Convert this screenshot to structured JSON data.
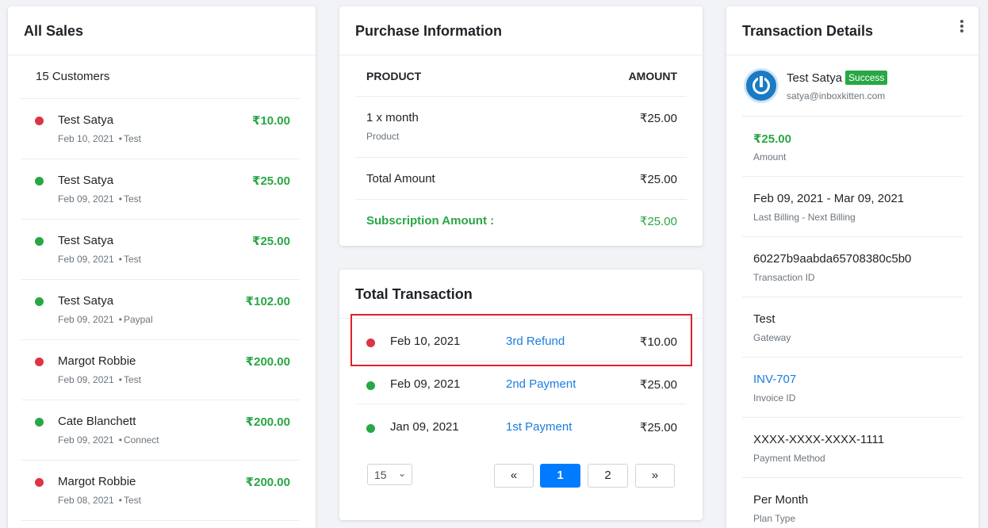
{
  "all_sales": {
    "title": "All Sales",
    "customers_count": "15 Customers",
    "items": [
      {
        "name": "Test Satya",
        "date": "Feb 10, 2021",
        "gateway": "Test",
        "amount": "₹10.00",
        "status_color": "#dc3545"
      },
      {
        "name": "Test Satya",
        "date": "Feb 09, 2021",
        "gateway": "Test",
        "amount": "₹25.00",
        "status_color": "#28a745"
      },
      {
        "name": "Test Satya",
        "date": "Feb 09, 2021",
        "gateway": "Test",
        "amount": "₹25.00",
        "status_color": "#28a745"
      },
      {
        "name": "Test Satya",
        "date": "Feb 09, 2021",
        "gateway": "Paypal",
        "amount": "₹102.00",
        "status_color": "#28a745"
      },
      {
        "name": "Margot Robbie",
        "date": "Feb 09, 2021",
        "gateway": "Test",
        "amount": "₹200.00",
        "status_color": "#dc3545"
      },
      {
        "name": "Cate Blanchett",
        "date": "Feb 09, 2021",
        "gateway": "Connect",
        "amount": "₹200.00",
        "status_color": "#28a745"
      },
      {
        "name": "Margot Robbie",
        "date": "Feb 08, 2021",
        "gateway": "Test",
        "amount": "₹200.00",
        "status_color": "#dc3545"
      }
    ]
  },
  "purchase": {
    "title": "Purchase Information",
    "col_product": "PRODUCT",
    "col_amount": "AMOUNT",
    "product_name": "1 x month",
    "product_sub": "Product",
    "product_amount": "₹25.00",
    "total_label": "Total Amount",
    "total_amount": "₹25.00",
    "subscription_label": "Subscription Amount :",
    "subscription_amount": "₹25.00"
  },
  "total_transaction": {
    "title": "Total Transaction",
    "rows": [
      {
        "date": "Feb 10, 2021",
        "label": "3rd Refund",
        "amount": "₹10.00",
        "status_color": "#dc3545"
      },
      {
        "date": "Feb 09, 2021",
        "label": "2nd Payment",
        "amount": "₹25.00",
        "status_color": "#28a745"
      },
      {
        "date": "Jan 09, 2021",
        "label": "1st Payment",
        "amount": "₹25.00",
        "status_color": "#28a745"
      }
    ],
    "per_page": "15",
    "prev": "«",
    "page1": "1",
    "page2": "2",
    "next": "»"
  },
  "details": {
    "title": "Transaction Details",
    "user_name": "Test Satya",
    "status_badge": "Success",
    "email": "satya@inboxkitten.com",
    "amount": "₹25.00",
    "amount_label": "Amount",
    "billing": "Feb 09, 2021 - Mar 09, 2021",
    "billing_label": "Last Billing - Next Billing",
    "transaction_id": "60227b9aabda65708380c5b0",
    "transaction_id_label": "Transaction ID",
    "gateway": "Test",
    "gateway_label": "Gateway",
    "invoice_id": "INV-707",
    "invoice_id_label": "Invoice ID",
    "payment_method": "XXXX-XXXX-XXXX-1111",
    "payment_method_label": "Payment Method",
    "plan_type": "Per Month",
    "plan_type_label": "Plan Type"
  },
  "colors": {
    "green": "#28a745",
    "red": "#dc3545",
    "link_blue": "#1a7de0",
    "primary": "#007bff"
  }
}
